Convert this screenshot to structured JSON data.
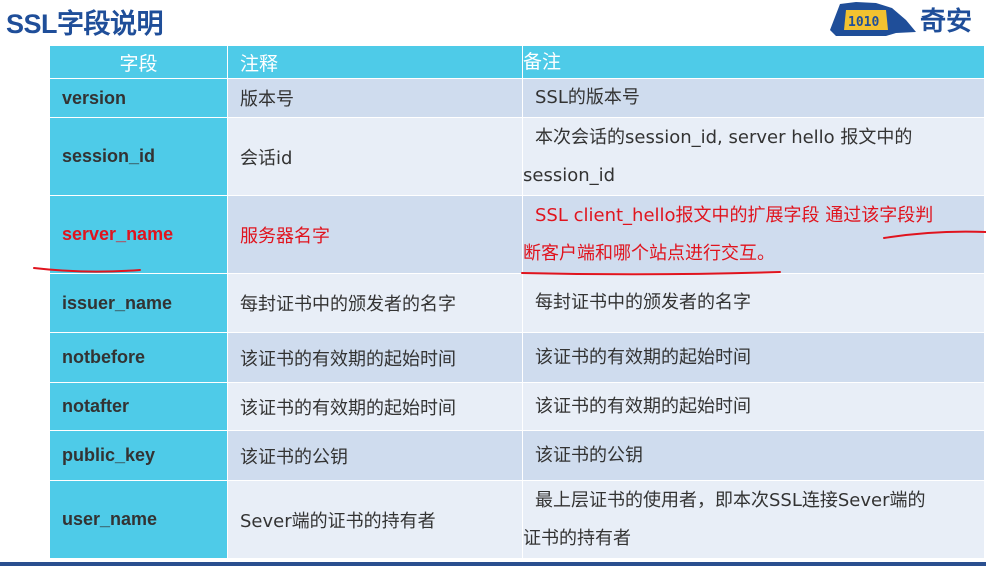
{
  "title": "SSL字段说明",
  "logo": {
    "text": "奇安",
    "mark_text": "1010"
  },
  "colors": {
    "title": "#1f4e99",
    "header": "#4ecbe8",
    "row_odd": "#cfdcee",
    "row_even": "#e8eef7",
    "highlight": "#e0141e"
  },
  "table": {
    "headers": [
      "字段",
      "注释",
      "备注"
    ],
    "rows": [
      {
        "field": "version",
        "comment": "版本号",
        "remark_lines": [
          "SSL的版本号"
        ]
      },
      {
        "field": "session_id",
        "comment": "会话id",
        "remark_lines": [
          "本次会话的session_id, server hello 报文中的",
          "session_id"
        ]
      },
      {
        "field": "server_name",
        "comment": "服务器名字",
        "remark_lines": [
          "SSL client_hello报文中的扩展字段 通过该字段判",
          "断客户端和哪个站点进行交互。"
        ],
        "highlighted": true
      },
      {
        "field": "issuer_name",
        "comment": "每封证书中的颁发者的名字",
        "remark_lines": [
          "每封证书中的颁发者的名字"
        ]
      },
      {
        "field": "notbefore",
        "comment": "该证书的有效期的起始时间",
        "remark_lines": [
          "该证书的有效期的起始时间"
        ]
      },
      {
        "field": "notafter",
        "comment": "该证书的有效期的起始时间",
        "remark_lines": [
          "该证书的有效期的起始时间"
        ]
      },
      {
        "field": "public_key",
        "comment": "该证书的公钥",
        "remark_lines": [
          "该证书的公钥"
        ]
      },
      {
        "field": "user_name",
        "comment": "Sever端的证书的持有者",
        "remark_lines": [
          "最上层证书的使用者，即本次SSL连接Sever端的",
          "证书的持有者"
        ]
      }
    ]
  }
}
